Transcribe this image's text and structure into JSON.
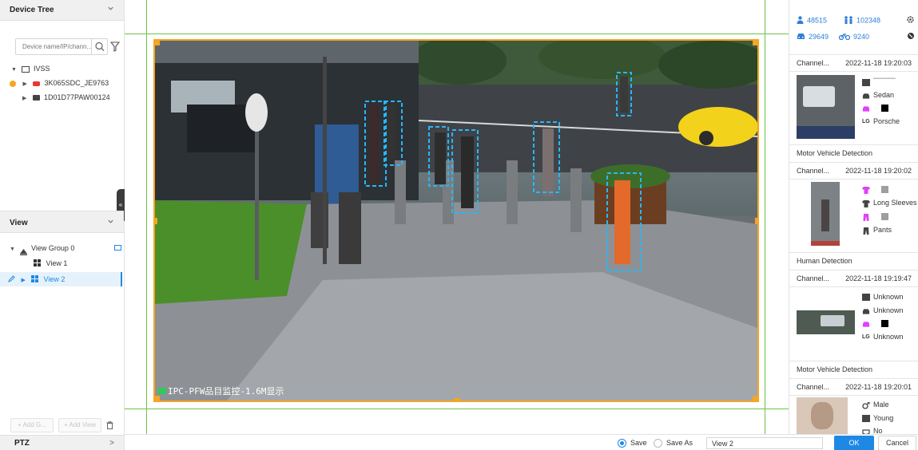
{
  "device_tree": {
    "title": "Device Tree",
    "search_placeholder": "Device name/IP/chann...",
    "nodes": [
      {
        "label": "IVSS"
      },
      {
        "label": "3K065SDC_JE9763"
      },
      {
        "label": "1D01D77PAW00124"
      }
    ]
  },
  "view": {
    "title": "View",
    "nodes": [
      {
        "label": "View Group 0"
      },
      {
        "label": "View 1"
      },
      {
        "label": "View 2"
      }
    ],
    "add_group_label": "+ Add G...",
    "add_view_label": "+ Add View"
  },
  "ptz": {
    "title": "PTZ",
    "toggle": ">"
  },
  "video": {
    "osd_text": "IPC-PFW品目监控-1.6M显示"
  },
  "stats": {
    "people": "48515",
    "pedestrians": "102348",
    "vehicles": "29649",
    "non_motor": "9240"
  },
  "events": [
    {
      "channel": "Channel...",
      "time": "2022-11-18 19:20:03",
      "attrs": {
        "plate": "▔▔▔▔",
        "vehicle_type": "Sedan",
        "brand": "Porsche"
      },
      "color": "#000000",
      "footer": "Motor Vehicle Detection"
    },
    {
      "channel": "Channel...",
      "time": "2022-11-18 19:20:02",
      "attrs": {
        "sleeves": "Long Sleeves",
        "pants": "Pants"
      },
      "top_color": "#9e9e9e",
      "bottom_color": "#9e9e9e",
      "footer": "Human Detection"
    },
    {
      "channel": "Channel...",
      "time": "2022-11-18 19:19:47",
      "attrs": {
        "plate": "Unknown",
        "vehicle_type": "Unknown",
        "brand": "Unknown"
      },
      "color": "#000000",
      "footer": "Motor Vehicle Detection"
    },
    {
      "channel": "Channel...",
      "time": "2022-11-18 19:20:01",
      "attrs": {
        "gender": "Male",
        "age": "Young",
        "mask": "No"
      }
    }
  ],
  "bottom_bar": {
    "save_label": "Save",
    "save_as_label": "Save As",
    "view_name": "View 2",
    "ok_label": "OK",
    "cancel_label": "Cancel"
  },
  "colors": {
    "accent": "#1e88e5",
    "grid_line": "#6cc24a",
    "frame": "#f5a623",
    "detection_box": "#29b6f6"
  }
}
